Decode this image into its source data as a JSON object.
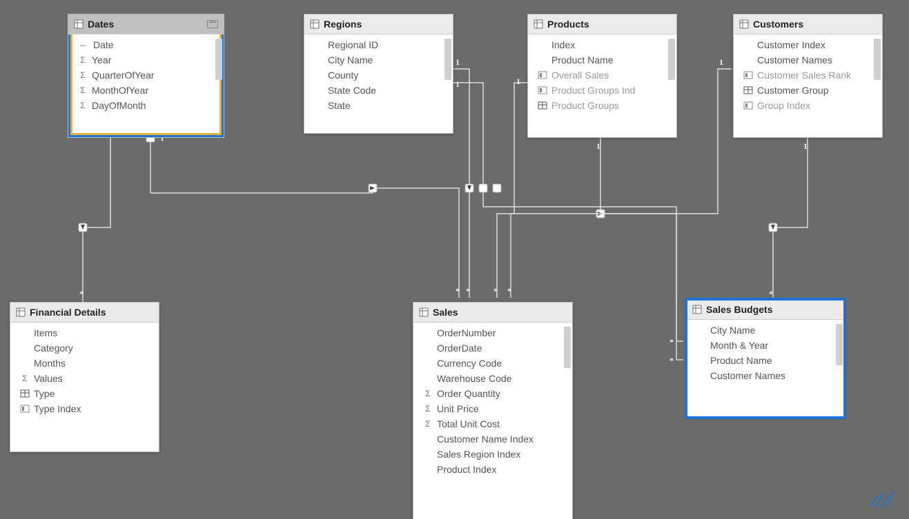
{
  "tables": {
    "dates": {
      "title": "Dates",
      "fields": [
        {
          "label": "Date",
          "icon": "arrows"
        },
        {
          "label": "Year",
          "icon": "sigma"
        },
        {
          "label": "QuarterOfYear",
          "icon": "sigma"
        },
        {
          "label": "MonthOfYear",
          "icon": "sigma"
        },
        {
          "label": "DayOfMonth",
          "icon": "sigma"
        }
      ]
    },
    "regions": {
      "title": "Regions",
      "fields": [
        {
          "label": "Regional ID",
          "icon": ""
        },
        {
          "label": "City Name",
          "icon": ""
        },
        {
          "label": "County",
          "icon": ""
        },
        {
          "label": "State Code",
          "icon": ""
        },
        {
          "label": "State",
          "icon": ""
        }
      ]
    },
    "products": {
      "title": "Products",
      "fields": [
        {
          "label": "Index",
          "icon": ""
        },
        {
          "label": "Product Name",
          "icon": ""
        },
        {
          "label": "Overall Sales",
          "icon": "calc",
          "dim": true
        },
        {
          "label": "Product Groups Ind",
          "icon": "calc",
          "dim": true
        },
        {
          "label": "Product Groups",
          "icon": "calc2",
          "dim": true
        }
      ]
    },
    "customers": {
      "title": "Customers",
      "fields": [
        {
          "label": "Customer Index",
          "icon": ""
        },
        {
          "label": "Customer Names",
          "icon": ""
        },
        {
          "label": "Customer Sales Rank",
          "icon": "calc",
          "dim": true
        },
        {
          "label": "Customer Group",
          "icon": "calc2"
        },
        {
          "label": "Group Index",
          "icon": "calc",
          "dim": true
        }
      ]
    },
    "financial": {
      "title": "Financial Details",
      "fields": [
        {
          "label": "Items",
          "icon": ""
        },
        {
          "label": "Category",
          "icon": ""
        },
        {
          "label": "Months",
          "icon": ""
        },
        {
          "label": "Values",
          "icon": "sigma"
        },
        {
          "label": "Type",
          "icon": "calc2"
        },
        {
          "label": "Type Index",
          "icon": "calc"
        }
      ]
    },
    "sales": {
      "title": "Sales",
      "fields": [
        {
          "label": "OrderNumber",
          "icon": ""
        },
        {
          "label": "OrderDate",
          "icon": ""
        },
        {
          "label": "Currency Code",
          "icon": ""
        },
        {
          "label": "Warehouse Code",
          "icon": ""
        },
        {
          "label": "Order Quantity",
          "icon": "sigma"
        },
        {
          "label": "Unit Price",
          "icon": "sigma"
        },
        {
          "label": "Total Unit Cost",
          "icon": "sigma"
        },
        {
          "label": "Customer Name Index",
          "icon": ""
        },
        {
          "label": "Sales Region Index",
          "icon": ""
        },
        {
          "label": "Product Index",
          "icon": ""
        }
      ]
    },
    "budgets": {
      "title": "Sales Budgets",
      "fields": [
        {
          "label": "City Name",
          "icon": ""
        },
        {
          "label": "Month & Year",
          "icon": ""
        },
        {
          "label": "Product Name",
          "icon": ""
        },
        {
          "label": "Customer Names",
          "icon": ""
        }
      ]
    }
  },
  "cardinality": {
    "one": "1",
    "many": "*"
  }
}
